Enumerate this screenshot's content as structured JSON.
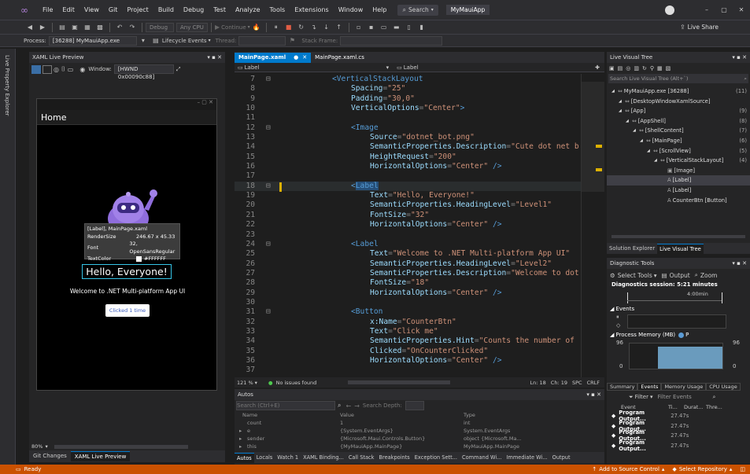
{
  "menu": {
    "items": [
      "File",
      "Edit",
      "View",
      "Git",
      "Project",
      "Build",
      "Debug",
      "Test",
      "Analyze",
      "Tools",
      "Extensions",
      "Window",
      "Help"
    ],
    "search_label": "Search",
    "solution_name": "MyMauiApp"
  },
  "toolbar": {
    "config": "Debug",
    "platform": "Any CPU",
    "continue_label": "Continue",
    "live_share": "Live Share"
  },
  "process_bar": {
    "process_label": "Process:",
    "process_value": "[36288] MyMauiApp.exe",
    "lifecycle_label": "Lifecycle Events",
    "thread_label": "Thread:",
    "stack_label": "Stack Frame:"
  },
  "left_strip": {
    "label": "Live Property Explorer"
  },
  "xaml_preview": {
    "title": "XAML Live Preview",
    "window_label": "Window:",
    "window_value": "[HWND 0x00090c88]",
    "app_header": "Home",
    "tooltip": {
      "line1": "[Label], MainPage.xaml",
      "render_key": "RenderSize",
      "render_val": "246.67 x 45.33",
      "font_key": "Font",
      "font_val": "32, OpenSansRegular",
      "color_key": "TextColor",
      "color_val": "#FFFFFF"
    },
    "hello_text": "Hello, Everyone!",
    "welcome_text": "Welcome to .NET Multi-platform App UI",
    "button_text": "Clicked 1 time",
    "zoom": "80%",
    "bottom_tabs": [
      "Git Changes",
      "XAML Live Preview"
    ]
  },
  "editor": {
    "tabs": [
      {
        "label": "MainPage.xaml",
        "active": true
      },
      {
        "label": "MainPage.xaml.cs",
        "active": false
      }
    ],
    "nav_left": "Label",
    "nav_right": "Label",
    "status": {
      "zoom": "121 %",
      "issues": "No issues found",
      "ln": "Ln: 18",
      "ch": "Ch: 19",
      "spc": "SPC",
      "crlf": "CRLF"
    }
  },
  "code_lines": [
    {
      "n": "7",
      "i": 2,
      "t": [
        [
          "tg",
          "<"
        ],
        [
          "kw",
          "VerticalStackLayout"
        ]
      ]
    },
    {
      "n": "8",
      "i": 3,
      "t": [
        [
          "at",
          "Spacing"
        ],
        [
          "pt",
          "="
        ],
        [
          "st",
          "\"25\""
        ]
      ]
    },
    {
      "n": "9",
      "i": 3,
      "t": [
        [
          "at",
          "Padding"
        ],
        [
          "pt",
          "="
        ],
        [
          "st",
          "\"30,0\""
        ]
      ]
    },
    {
      "n": "10",
      "i": 3,
      "t": [
        [
          "at",
          "VerticalOptions"
        ],
        [
          "pt",
          "="
        ],
        [
          "st",
          "\"Center\""
        ],
        [
          "tg",
          ">"
        ]
      ]
    },
    {
      "n": "11",
      "i": 0,
      "t": []
    },
    {
      "n": "12",
      "i": 3,
      "t": [
        [
          "tg",
          "<"
        ],
        [
          "kw",
          "Image"
        ]
      ]
    },
    {
      "n": "13",
      "i": 4,
      "t": [
        [
          "at",
          "Source"
        ],
        [
          "pt",
          "="
        ],
        [
          "st",
          "\"dotnet_bot.png\""
        ]
      ]
    },
    {
      "n": "14",
      "i": 4,
      "t": [
        [
          "at",
          "SemanticProperties.Description"
        ],
        [
          "pt",
          "="
        ],
        [
          "st",
          "\"Cute dot net b"
        ]
      ]
    },
    {
      "n": "15",
      "i": 4,
      "t": [
        [
          "at",
          "HeightRequest"
        ],
        [
          "pt",
          "="
        ],
        [
          "st",
          "\"200\""
        ]
      ]
    },
    {
      "n": "16",
      "i": 4,
      "t": [
        [
          "at",
          "HorizontalOptions"
        ],
        [
          "pt",
          "="
        ],
        [
          "st",
          "\"Center\" "
        ],
        [
          "tg",
          "/>"
        ]
      ]
    },
    {
      "n": "17",
      "i": 0,
      "t": []
    },
    {
      "n": "18",
      "i": 3,
      "t": [
        [
          "tg",
          "<"
        ],
        [
          "kw",
          "Label"
        ]
      ]
    },
    {
      "n": "19",
      "i": 4,
      "t": [
        [
          "at",
          "Text"
        ],
        [
          "pt",
          "="
        ],
        [
          "st",
          "\"Hello, Everyone!\""
        ]
      ]
    },
    {
      "n": "20",
      "i": 4,
      "t": [
        [
          "at",
          "SemanticProperties.HeadingLevel"
        ],
        [
          "pt",
          "="
        ],
        [
          "st",
          "\"Level1\""
        ]
      ]
    },
    {
      "n": "21",
      "i": 4,
      "t": [
        [
          "at",
          "FontSize"
        ],
        [
          "pt",
          "="
        ],
        [
          "st",
          "\"32\""
        ]
      ]
    },
    {
      "n": "22",
      "i": 4,
      "t": [
        [
          "at",
          "HorizontalOptions"
        ],
        [
          "pt",
          "="
        ],
        [
          "st",
          "\"Center\" "
        ],
        [
          "tg",
          "/>"
        ]
      ]
    },
    {
      "n": "23",
      "i": 0,
      "t": []
    },
    {
      "n": "24",
      "i": 3,
      "t": [
        [
          "tg",
          "<"
        ],
        [
          "kw",
          "Label"
        ]
      ]
    },
    {
      "n": "25",
      "i": 4,
      "t": [
        [
          "at",
          "Text"
        ],
        [
          "pt",
          "="
        ],
        [
          "st",
          "\"Welcome to .NET Multi-platform App UI\""
        ]
      ]
    },
    {
      "n": "26",
      "i": 4,
      "t": [
        [
          "at",
          "SemanticProperties.HeadingLevel"
        ],
        [
          "pt",
          "="
        ],
        [
          "st",
          "\"Level2\""
        ]
      ]
    },
    {
      "n": "27",
      "i": 4,
      "t": [
        [
          "at",
          "SemanticProperties.Description"
        ],
        [
          "pt",
          "="
        ],
        [
          "st",
          "\"Welcome to dot"
        ]
      ]
    },
    {
      "n": "28",
      "i": 4,
      "t": [
        [
          "at",
          "FontSize"
        ],
        [
          "pt",
          "="
        ],
        [
          "st",
          "\"18\""
        ]
      ]
    },
    {
      "n": "29",
      "i": 4,
      "t": [
        [
          "at",
          "HorizontalOptions"
        ],
        [
          "pt",
          "="
        ],
        [
          "st",
          "\"Center\" "
        ],
        [
          "tg",
          "/>"
        ]
      ]
    },
    {
      "n": "30",
      "i": 0,
      "t": []
    },
    {
      "n": "31",
      "i": 3,
      "t": [
        [
          "tg",
          "<"
        ],
        [
          "kw",
          "Button"
        ]
      ]
    },
    {
      "n": "32",
      "i": 4,
      "t": [
        [
          "at",
          "x:Name"
        ],
        [
          "pt",
          "="
        ],
        [
          "st",
          "\"CounterBtn\""
        ]
      ]
    },
    {
      "n": "33",
      "i": 4,
      "t": [
        [
          "at",
          "Text"
        ],
        [
          "pt",
          "="
        ],
        [
          "st",
          "\"Click me\""
        ]
      ]
    },
    {
      "n": "34",
      "i": 4,
      "t": [
        [
          "at",
          "SemanticProperties.Hint"
        ],
        [
          "pt",
          "="
        ],
        [
          "st",
          "\"Counts the number of"
        ]
      ]
    },
    {
      "n": "35",
      "i": 4,
      "t": [
        [
          "at",
          "Clicked"
        ],
        [
          "pt",
          "="
        ],
        [
          "st",
          "\"OnCounterClicked\""
        ]
      ]
    },
    {
      "n": "36",
      "i": 4,
      "t": [
        [
          "at",
          "HorizontalOptions"
        ],
        [
          "pt",
          "="
        ],
        [
          "st",
          "\"Center\" "
        ],
        [
          "tg",
          "/>"
        ]
      ]
    },
    {
      "n": "37",
      "i": 0,
      "t": []
    }
  ],
  "autos": {
    "title": "Autos",
    "search_placeholder": "Search (Ctrl+E)",
    "depth_label": "Search Depth:",
    "columns": [
      "Name",
      "Value",
      "Type"
    ],
    "rows": [
      {
        "name": "count",
        "value": "1",
        "type": "int"
      },
      {
        "name": "e",
        "value": "{System.EventArgs}",
        "type": "System.EventArgs"
      },
      {
        "name": "sender",
        "value": "{Microsoft.Maui.Controls.Button}",
        "type": "object {Microsoft.Ma..."
      },
      {
        "name": "this",
        "value": "{MyMauiApp.MainPage}",
        "type": "MyMauiApp.MainPage"
      }
    ],
    "bottom_tabs": [
      "Autos",
      "Locals",
      "Watch 1",
      "XAML Binding...",
      "Call Stack",
      "Breakpoints",
      "Exception Sett...",
      "Command Wi...",
      "Immediate Wi...",
      "Output"
    ]
  },
  "live_tree": {
    "title": "Live Visual Tree",
    "search_placeholder": "Search Live Visual Tree (Alt+`)",
    "items": [
      {
        "label": "MyMauiApp.exe [36288]",
        "count": "(11)",
        "indent": 0
      },
      {
        "label": "[DesktopWindowXamlSource]",
        "count": "",
        "indent": 1
      },
      {
        "label": "[App]",
        "count": "(9)",
        "indent": 1
      },
      {
        "label": "[AppShell]",
        "count": "(8)",
        "indent": 2
      },
      {
        "label": "[ShellContent]",
        "count": "(7)",
        "indent": 3
      },
      {
        "label": "[MainPage]",
        "count": "(6)",
        "indent": 4
      },
      {
        "label": "[ScrollView]",
        "count": "(5)",
        "indent": 5
      },
      {
        "label": "[VerticalStackLayout]",
        "count": "(4)",
        "indent": 6
      },
      {
        "label": "[Image]",
        "count": "",
        "indent": 7
      },
      {
        "label": "[Label]",
        "count": "",
        "indent": 7
      },
      {
        "label": "[Label]",
        "count": "",
        "indent": 7
      },
      {
        "label": "CounterBtn [Button]",
        "count": "",
        "indent": 7
      }
    ],
    "bottom_tabs": [
      "Solution Explorer",
      "Live Visual Tree"
    ]
  },
  "diagnostics": {
    "title": "Diagnostic Tools",
    "select_tools": "Select Tools",
    "output": "Output",
    "zoom": "Zoom",
    "session": "Diagnostics session: 5:21 minutes",
    "time_marker": "4:00min",
    "events_label": "Events",
    "memory_label": "Process Memory (MB)",
    "memory_legend": "P",
    "mem_max": "96",
    "mem_min": "0",
    "tabs": [
      "Summary",
      "Events",
      "Memory Usage",
      "CPU Usage"
    ],
    "filter_label": "Filter",
    "filter_events": "Filter Events",
    "columns": [
      "Event",
      "Ti...",
      "Durat...",
      "Thre..."
    ],
    "events": [
      {
        "name": "Program Output...",
        "time": "27.47s"
      },
      {
        "name": "Program Output...",
        "time": "27.47s"
      },
      {
        "name": "Program Output...",
        "time": "27.47s"
      },
      {
        "name": "Program Output...",
        "time": "27.47s"
      }
    ]
  },
  "status": {
    "ready": "Ready",
    "source_control": "Add to Source Control",
    "repository": "Select Repository"
  }
}
